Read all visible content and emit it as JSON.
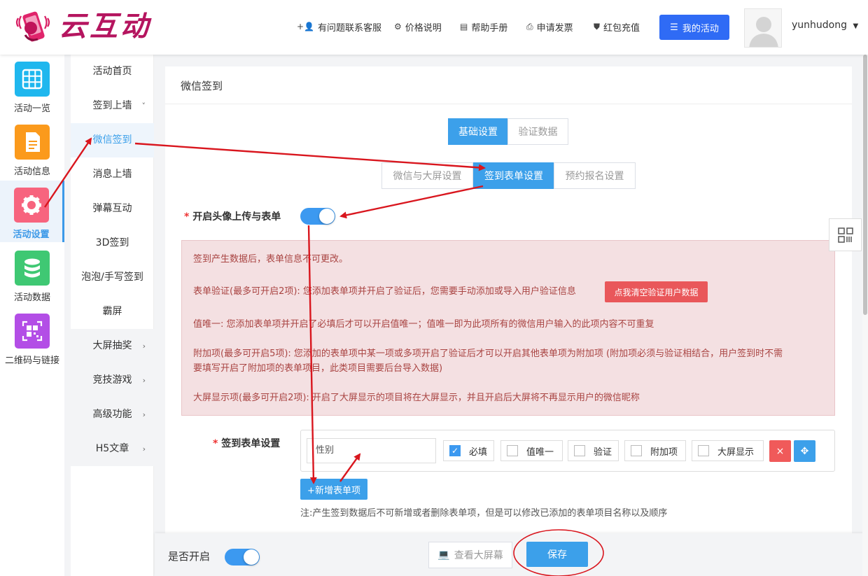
{
  "brand": {
    "name": "云互动"
  },
  "topnav": {
    "support": "有问题联系客服",
    "pricing": "价格说明",
    "manual": "帮助手册",
    "invoice": "申请发票",
    "recharge": "红包充值",
    "my_activities": "我的活动",
    "username": "yunhudong"
  },
  "rail": [
    {
      "label": "活动一览",
      "icon": "grid-icon",
      "color": "#1fb7ee"
    },
    {
      "label": "活动信息",
      "icon": "document-icon",
      "color": "#fb9a1c"
    },
    {
      "label": "活动设置",
      "icon": "gear-icon",
      "color": "#f7647e"
    },
    {
      "label": "活动数据",
      "icon": "database-icon",
      "color": "#3fc873"
    },
    {
      "label": "二维码与链接",
      "icon": "qrcode-icon",
      "color": "#b34ee6"
    }
  ],
  "submenu": [
    {
      "label": "活动首页"
    },
    {
      "label": "签到上墙",
      "chevron": "˅"
    },
    {
      "label": "微信签到",
      "active": true
    },
    {
      "label": "消息上墙"
    },
    {
      "label": "弹幕互动"
    },
    {
      "label": "3D签到"
    },
    {
      "label": "泡泡/手写签到"
    },
    {
      "label": "霸屏"
    },
    {
      "label": "大屏抽奖",
      "chevron": "›"
    },
    {
      "label": "竞技游戏",
      "chevron": "›"
    },
    {
      "label": "高级功能",
      "chevron": "›"
    },
    {
      "label": "H5文章",
      "chevron": "›"
    }
  ],
  "panel": {
    "title": "微信签到",
    "tabs": {
      "basic": "基础设置",
      "verify": "验证数据"
    },
    "subtabs": {
      "wechat_screen": "微信与大屏设置",
      "form": "签到表单设置",
      "booking": "预约报名设置"
    },
    "avatar_toggle_label": "开启头像上传与表单",
    "avatar_toggle_on": true,
    "notice": {
      "line1": "签到产生数据后，表单信息不可更改。",
      "line2": "表单验证(最多可开启2项): 您添加表单项并开启了验证后，您需要手动添加或导入用户验证信息",
      "clear_button": "点我清空验证用户数据",
      "line3": "值唯一: 您添加表单项并开启了必填后才可以开启值唯一；值唯一即为此项所有的微信用户输入的此项内容不可重复",
      "line4a": "附加项(最多可开启5项): 您添加的表单项中某一项或多项开启了验证后才可以开启其他表单项为附加项 (附加项必须与验证相结合，用户签到时不需",
      "line4b": "要填写开启了附加项的表单项目，此类项目需要后台导入数据)",
      "line5": "大屏显示项(最多可开启2项): 开启了大屏显示的项目将在大屏显示，并且开启后大屏将不再显示用户的微信昵称"
    },
    "form_label": "签到表单设置",
    "form_item": {
      "value": "性别",
      "required": "必填",
      "unique": "值唯一",
      "verify": "验证",
      "extra": "附加项",
      "screen": "大屏显示",
      "delete": "×",
      "move": "✥"
    },
    "add_button": "+新增表单项",
    "note": "注:产生签到数据后不可新增或者删除表单项，但是可以修改已添加的表单项目名称以及顺序"
  },
  "footer": {
    "enable_label": "是否开启",
    "enabled": true,
    "view_screen": "查看大屏幕",
    "save": "保存"
  },
  "colors": {
    "primary": "#3ca0ea",
    "annotation": "#d9161e",
    "brand": "#b5155f"
  }
}
